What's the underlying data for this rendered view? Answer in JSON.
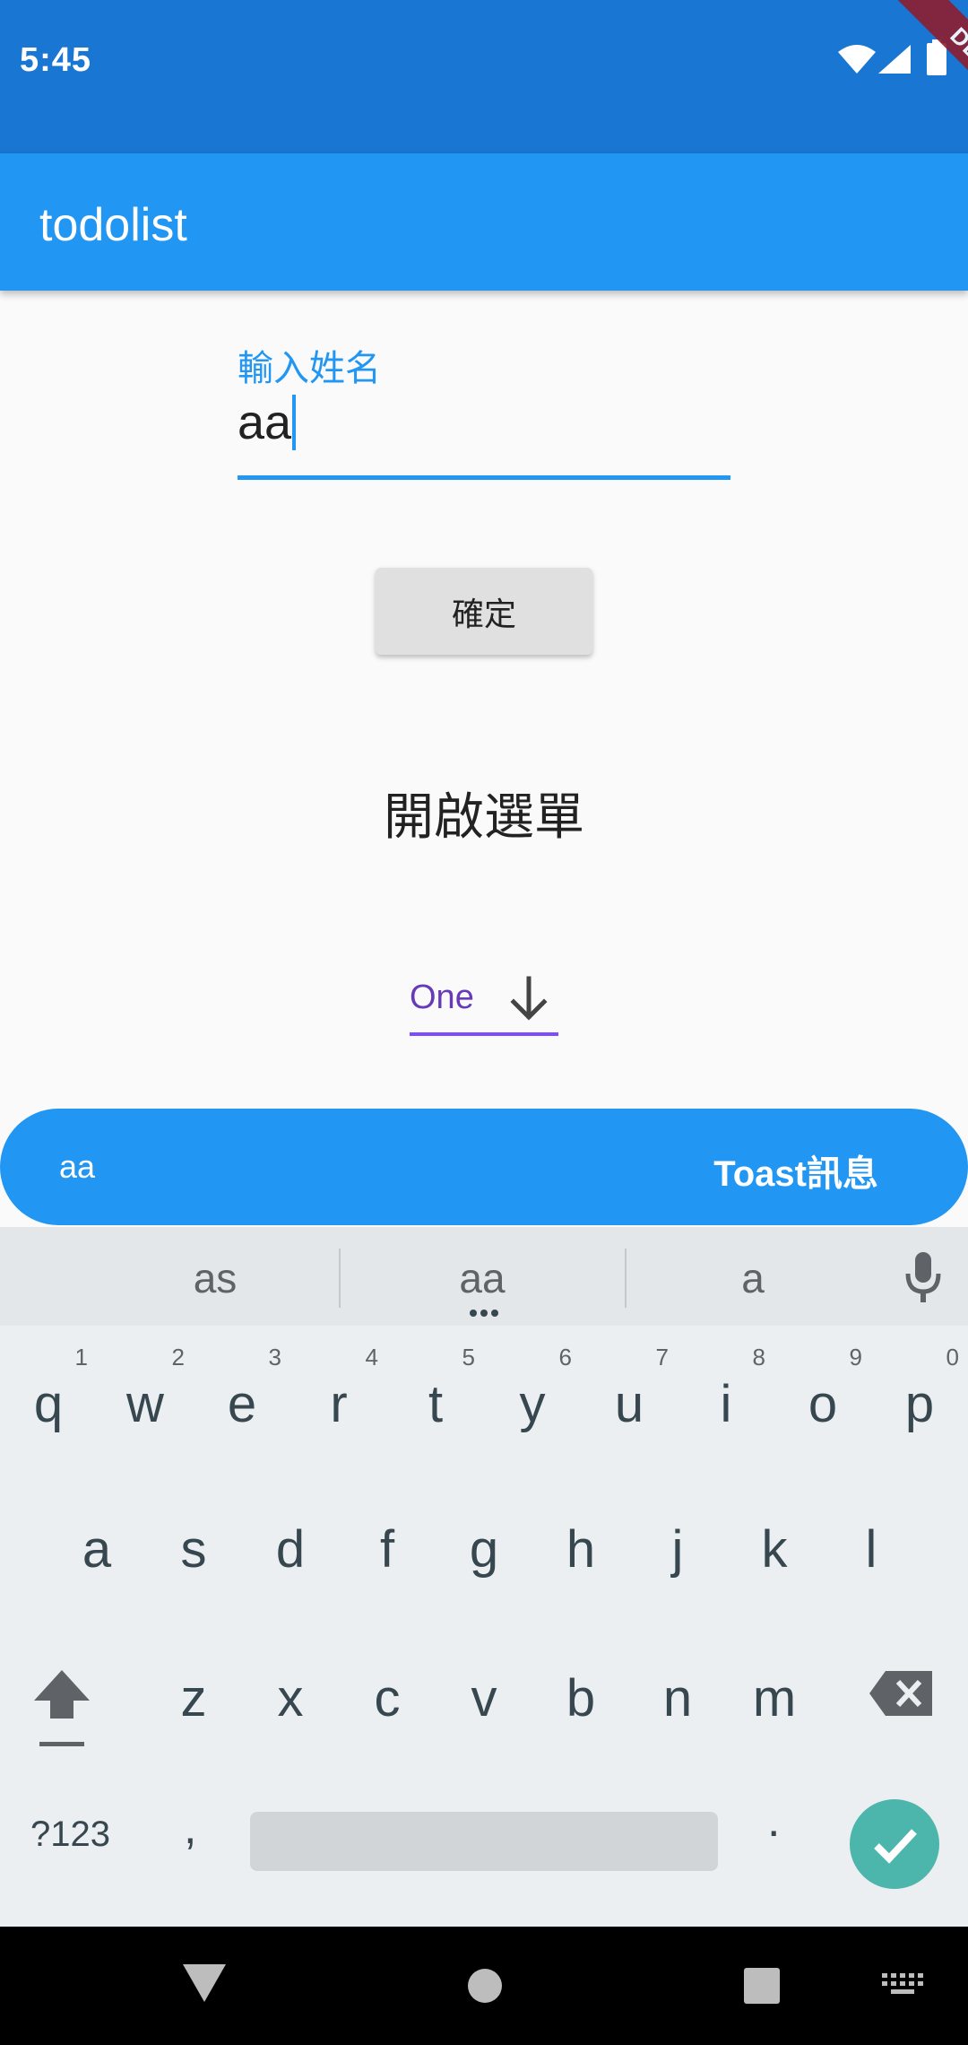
{
  "status_bar": {
    "time": "5:45",
    "debug_label": "DEBUG"
  },
  "app_bar": {
    "title": "todolist"
  },
  "form": {
    "name_label": "輸入姓名",
    "name_value": "aa",
    "confirm_label": "確定",
    "menu_text": "開啟選單",
    "dropdown_value": "One"
  },
  "toast": {
    "left_text": "aa",
    "right_text": "Toast訊息"
  },
  "keyboard": {
    "suggestions": [
      "as",
      "aa",
      "a"
    ],
    "row1": [
      {
        "ch": "q",
        "digit": "1"
      },
      {
        "ch": "w",
        "digit": "2"
      },
      {
        "ch": "e",
        "digit": "3"
      },
      {
        "ch": "r",
        "digit": "4"
      },
      {
        "ch": "t",
        "digit": "5"
      },
      {
        "ch": "y",
        "digit": "6"
      },
      {
        "ch": "u",
        "digit": "7"
      },
      {
        "ch": "i",
        "digit": "8"
      },
      {
        "ch": "o",
        "digit": "9"
      },
      {
        "ch": "p",
        "digit": "0"
      }
    ],
    "row2": [
      "a",
      "s",
      "d",
      "f",
      "g",
      "h",
      "j",
      "k",
      "l"
    ],
    "row3": [
      "z",
      "x",
      "c",
      "v",
      "b",
      "n",
      "m"
    ],
    "symbols_label": "?123",
    "comma": ",",
    "period": "."
  },
  "colors": {
    "status_bar": "#1976d2",
    "app_bar": "#2196f3",
    "accent": "#2196f3",
    "dropdown": "#673ab7",
    "enter_key": "#4db6ac"
  }
}
